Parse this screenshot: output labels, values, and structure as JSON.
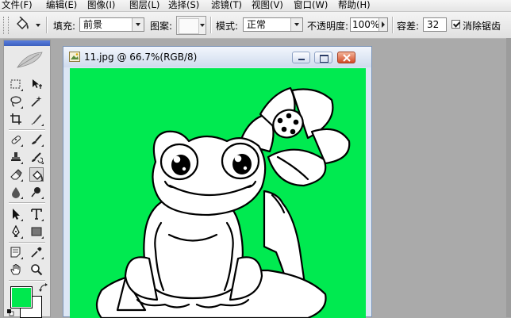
{
  "menubar": {
    "items": [
      "文件(F)",
      "编辑(E)",
      "图像(I)",
      "图层(L)",
      "选择(S)",
      "滤镜(T)",
      "视图(V)",
      "窗口(W)",
      "帮助(H)"
    ]
  },
  "options": {
    "fill_label": "填充:",
    "fill_value": "前景",
    "pattern_label": "图案:",
    "mode_label": "模式:",
    "mode_value": "正常",
    "opacity_label": "不透明度:",
    "opacity_value": "100%",
    "tolerance_label": "容差:",
    "tolerance_value": "32",
    "antialias_label": "消除锯齿",
    "antialias_checked": true
  },
  "toolbox": {
    "foreground_color": "#00e84e",
    "background_color": "#ffffff",
    "active_tool": "paint-bucket-icon"
  },
  "document": {
    "title": "11.jpg @ 66.7%(RGB/8)",
    "canvas_color": "#00ea50",
    "line_color": "#000000",
    "fill_color": "#ffffff"
  }
}
